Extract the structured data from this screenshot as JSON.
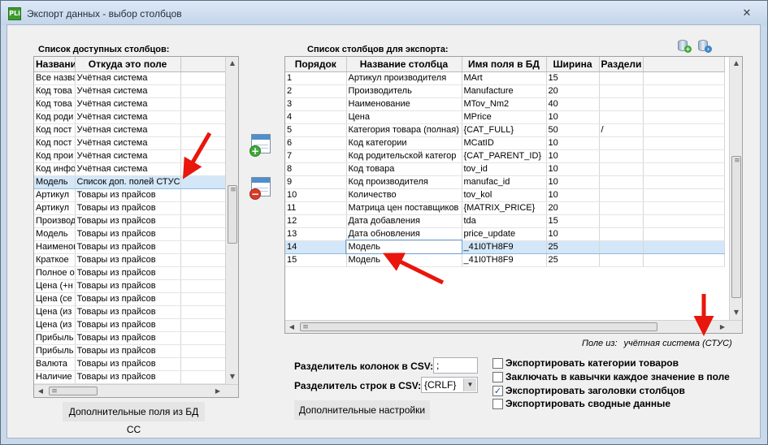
{
  "window": {
    "title": "Экспорт данных - выбор столбцов",
    "app_icon_text": "PLi",
    "close_glyph": "✕"
  },
  "available": {
    "title": "Список доступных столбцов:",
    "columns": [
      "Название",
      "Откуда это поле",
      ""
    ],
    "rows": [
      [
        "Все назва",
        "Учётная система"
      ],
      [
        "Код това",
        "Учётная система"
      ],
      [
        "Код това",
        "Учётная система"
      ],
      [
        "Код роди",
        "Учётная система"
      ],
      [
        "Код пост",
        "Учётная система"
      ],
      [
        "Код пост",
        "Учётная система"
      ],
      [
        "Код прои",
        "Учётная система"
      ],
      [
        "Код инфо",
        "Учётная система"
      ],
      [
        "Модель",
        "Список доп. полей СТУС"
      ],
      [
        "Артикул",
        "Товары из прайсов"
      ],
      [
        "Артикул",
        "Товары из прайсов"
      ],
      [
        "Производ",
        "Товары из прайсов"
      ],
      [
        "Модель",
        "Товары из прайсов"
      ],
      [
        "Наименов",
        "Товары из прайсов"
      ],
      [
        "Краткое",
        "Товары из прайсов"
      ],
      [
        "Полное о",
        "Товары из прайсов"
      ],
      [
        "Цена (+н",
        "Товары из прайсов"
      ],
      [
        "Цена (се",
        "Товары из прайсов"
      ],
      [
        "Цена (из",
        "Товары из прайсов"
      ],
      [
        "Цена (из",
        "Товары из прайсов"
      ],
      [
        "Прибыль",
        "Товары из прайсов"
      ],
      [
        "Прибыль",
        "Товары из прайсов"
      ],
      [
        "Валюта",
        "Товары из прайсов"
      ],
      [
        "Наличие",
        "Товары из прайсов"
      ]
    ],
    "selected_index": 8
  },
  "export": {
    "title": "Список столбцов для экспорта:",
    "columns": [
      "Порядок",
      "Название столбца",
      "Имя поля в БД",
      "Ширина",
      "Раздели"
    ],
    "rows": [
      [
        "1",
        "Артикул производителя",
        "MArt",
        "15",
        ""
      ],
      [
        "2",
        "Производитель",
        "Manufacture",
        "20",
        ""
      ],
      [
        "3",
        "Наименование",
        "MTov_Nm2",
        "40",
        ""
      ],
      [
        "4",
        "Цена",
        "MPrice",
        "10",
        ""
      ],
      [
        "5",
        "Категория товара (полная)",
        "{CAT_FULL}",
        "50",
        "/"
      ],
      [
        "6",
        "Код категории",
        "MCatID",
        "10",
        ""
      ],
      [
        "7",
        "Код родительской категор",
        "{CAT_PARENT_ID}",
        "10",
        ""
      ],
      [
        "8",
        "Код товара",
        "tov_id",
        "10",
        ""
      ],
      [
        "9",
        "Код производителя",
        "manufac_id",
        "10",
        ""
      ],
      [
        "10",
        "Количество",
        "tov_kol",
        "10",
        ""
      ],
      [
        "11",
        "Матрица цен поставщиков",
        "{MATRIX_PRICE}",
        "20",
        ""
      ],
      [
        "12",
        "Дата добавления",
        "tda",
        "15",
        ""
      ],
      [
        "13",
        "Дата обновления",
        "price_update",
        "10",
        ""
      ],
      [
        "14",
        "Модель",
        "_41I0TH8F9",
        "25",
        ""
      ],
      [
        "15",
        "Модель",
        "_41I0TH8F9",
        "25",
        ""
      ]
    ],
    "selected_index": 13,
    "field_from_label": "Поле из:",
    "field_from_value": "учётная система (СТУС)"
  },
  "icons": {
    "add_column": "add-column-icon",
    "remove_column": "remove-column-icon",
    "db_add": "database-add-icon",
    "db_export": "database-export-icon"
  },
  "csv": {
    "col_sep_label": "Разделитель колонок в CSV:",
    "col_sep_value": ";",
    "row_sep_label": "Разделитель строк в CSV:",
    "row_sep_value": "{CRLF}",
    "combo_arrow": "▼"
  },
  "buttons": {
    "extra_fields": "Дополнительные поля из БД СС",
    "extra_settings": "Дополнительные настройки"
  },
  "options": [
    {
      "label": "Экспортировать категории товаров",
      "checked": false
    },
    {
      "label": "Заключать в кавычки каждое значение в поле",
      "checked": false
    },
    {
      "label": "Экспортировать заголовки столбцов",
      "checked": true
    },
    {
      "label": "Экспортировать сводные данные",
      "checked": false
    }
  ],
  "colors": {
    "selection": "#d3e7f8",
    "annotation_arrow": "#e8160c"
  }
}
